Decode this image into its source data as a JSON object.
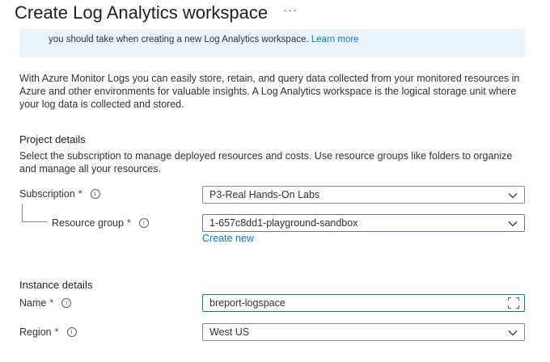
{
  "header": {
    "title": "Create Log Analytics workspace",
    "more_label": "···"
  },
  "banner": {
    "text": "you should take when creating a new Log Analytics workspace.",
    "link": "Learn more"
  },
  "intro_text": "With Azure Monitor Logs you can easily store, retain, and query data collected from your monitored resources in Azure and other environments for valuable insights. A Log Analytics workspace is the logical storage unit where your log data is collected and stored.",
  "project_details": {
    "title": "Project details",
    "description": "Select the subscription to manage deployed resources and costs. Use resource groups like folders to organize and manage all your resources.",
    "subscription": {
      "label": "Subscription",
      "required": "*",
      "value": "P3-Real Hands-On Labs"
    },
    "resource_group": {
      "label": "Resource group",
      "required": "*",
      "value": "1-657c8dd1-playground-sandbox",
      "create_new": "Create new"
    }
  },
  "instance_details": {
    "title": "Instance details",
    "name": {
      "label": "Name",
      "required": "*",
      "value": "breport-logspace"
    },
    "region": {
      "label": "Region",
      "required": "*",
      "value": "West US"
    }
  },
  "colors": {
    "accent": "#0078d4",
    "required": "#a4262c",
    "banner_bg": "#ebf3fc",
    "focus_border": "#8764b8"
  },
  "icons": {
    "info": "info-circle-icon",
    "dropdown": "chevron-down-icon",
    "expand": "expand-icon"
  }
}
